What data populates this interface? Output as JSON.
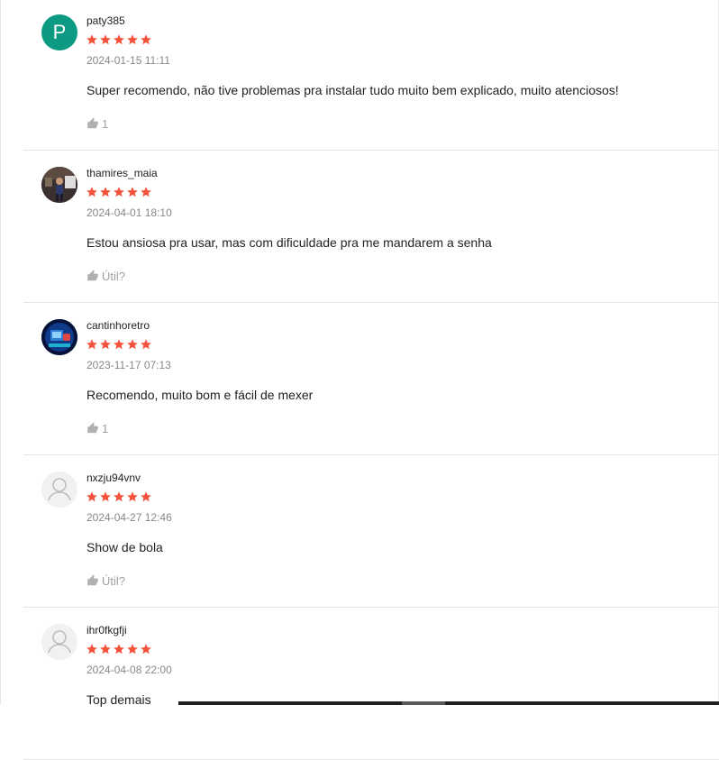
{
  "colors": {
    "star": "#f4523b",
    "avatar_p": "#0d9a83",
    "helpful_gray": "#9e9e9e",
    "divider": "#e5e5e5"
  },
  "reviews": [
    {
      "username": "paty385",
      "avatar": {
        "type": "letter",
        "letter": "P"
      },
      "rating": 5,
      "date": "2024-01-15 11:11",
      "text": "Super recomendo, não tive problemas pra instalar tudo muito bem explicado, muito atenciosos!",
      "helpful": "1"
    },
    {
      "username": "thamires_maia",
      "avatar": {
        "type": "photo"
      },
      "rating": 5,
      "date": "2024-04-01 18:10",
      "text": "Estou ansiosa pra usar, mas com dificuldade pra me mandarem a senha",
      "helpful": "Útil?"
    },
    {
      "username": "cantinhoretro",
      "avatar": {
        "type": "retro"
      },
      "rating": 5,
      "date": "2023-11-17 07:13",
      "text": "Recomendo, muito bom e fácil de mexer",
      "helpful": "1"
    },
    {
      "username": "nxzju94vnv",
      "avatar": {
        "type": "default"
      },
      "rating": 5,
      "date": "2024-04-27 12:46",
      "text": "Show de bola",
      "helpful": "Útil?"
    },
    {
      "username": "ihr0fkgfji",
      "avatar": {
        "type": "default"
      },
      "rating": 5,
      "date": "2024-04-08 22:00",
      "text": "Top demais",
      "helpful": ""
    }
  ],
  "icons": {
    "star": "star-icon",
    "thumb": "thumbs-up-icon",
    "default_avatar": "user-icon"
  }
}
